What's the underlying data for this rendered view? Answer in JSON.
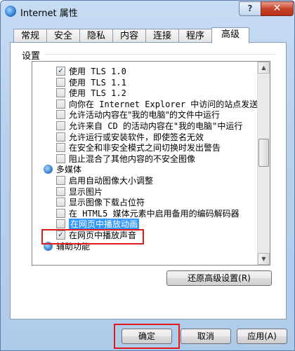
{
  "window": {
    "title": "Internet 属性"
  },
  "title_buttons": {
    "help": "?",
    "close": "✕"
  },
  "tabs": [
    "常规",
    "安全",
    "隐私",
    "内容",
    "连接",
    "程序",
    "高级"
  ],
  "group": {
    "label": "设置"
  },
  "settings_list": [
    {
      "label": "使用 TLS 1.0",
      "checked": true
    },
    {
      "label": "使用 TLS 1.1",
      "checked": false
    },
    {
      "label": "使用 TLS 1.2",
      "checked": false
    },
    {
      "label": "向你在 Internet Explorer 中访问的站点发送 \"Do Not",
      "checked": false
    },
    {
      "label": "允许活动内容在\"我的电脑\"的文件中运行",
      "checked": false
    },
    {
      "label": "允许来自 CD 的活动内容在\"我的电脑\"中运行",
      "checked": false
    },
    {
      "label": "允许运行或安装软件，即使签名无效",
      "checked": false
    },
    {
      "label": "在安全和非安全模式之间切换时发出警告",
      "checked": false
    },
    {
      "label": "阻止混合了其他内容的不安全图像",
      "checked": false
    }
  ],
  "category_multimedia": "多媒体",
  "multimedia_list": [
    {
      "label": "启用自动图像大小调整",
      "checked": false
    },
    {
      "label": "显示图片",
      "checked": false
    },
    {
      "label": "显示图像下载占位符",
      "checked": false
    },
    {
      "label": "在 HTML5 媒体元素中启用备用的编码解码器",
      "checked": false
    },
    {
      "label": "在网页中播放动画",
      "checked": false,
      "selected": true
    },
    {
      "label": "在网页中播放声音",
      "checked": true,
      "highlighted": true
    }
  ],
  "category_accessibility": "辅助功能",
  "restore_button": "还原高级设置(R)",
  "footer_buttons": {
    "ok": "确定",
    "cancel": "取消",
    "apply": "应用(A)"
  },
  "colors": {
    "highlight_box": "#e01a1a",
    "selection": "#3399ff"
  }
}
